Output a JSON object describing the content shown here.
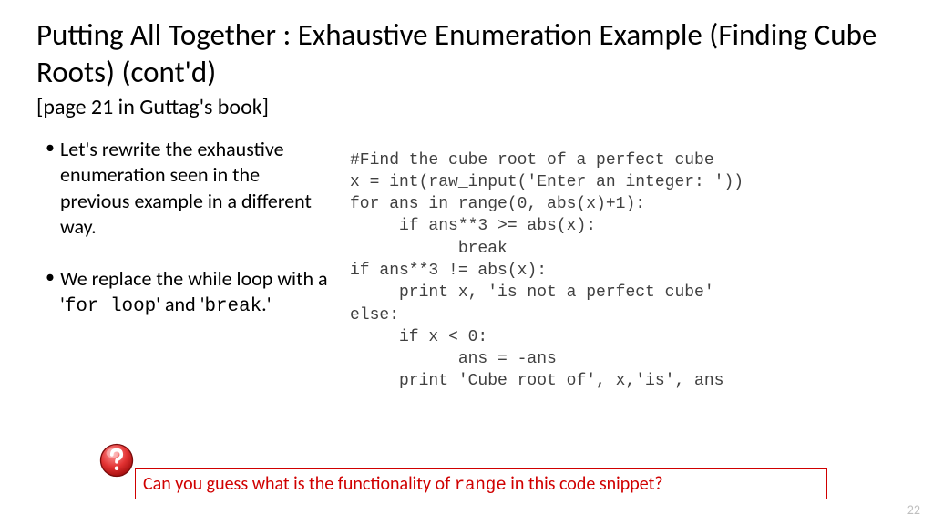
{
  "title": "Putting All Together : Exhaustive Enumeration Example (Finding Cube Roots) (cont'd)",
  "subtitle": "[page 21 in Guttag's book]",
  "bullets": {
    "b1": "Let's rewrite the exhaustive enumeration seen in the previous example in a different way.",
    "b2_pre": "We replace the while loop with a '",
    "b2_code1": "for loop",
    "b2_mid": "' and '",
    "b2_code2": "break",
    "b2_post": ".'"
  },
  "code": {
    "l1": "#Find the cube root of a perfect cube",
    "l2": "x = int(raw_input('Enter an integer: '))",
    "l3": "for ans in range(0, abs(x)+1):",
    "l4": "     if ans**3 >= abs(x):",
    "l5": "           break",
    "l6": "if ans**3 != abs(x):",
    "l7": "     print x, 'is not a perfect cube'",
    "l8": "else:",
    "l9": "     if x < 0:",
    "l10": "           ans = -ans",
    "l11": "     print 'Cube root of', x,'is', ans"
  },
  "footer": {
    "pre": "Can you guess what is the functionality of ",
    "code": "range",
    "post": " in this code snippet?"
  },
  "page_num": "22"
}
